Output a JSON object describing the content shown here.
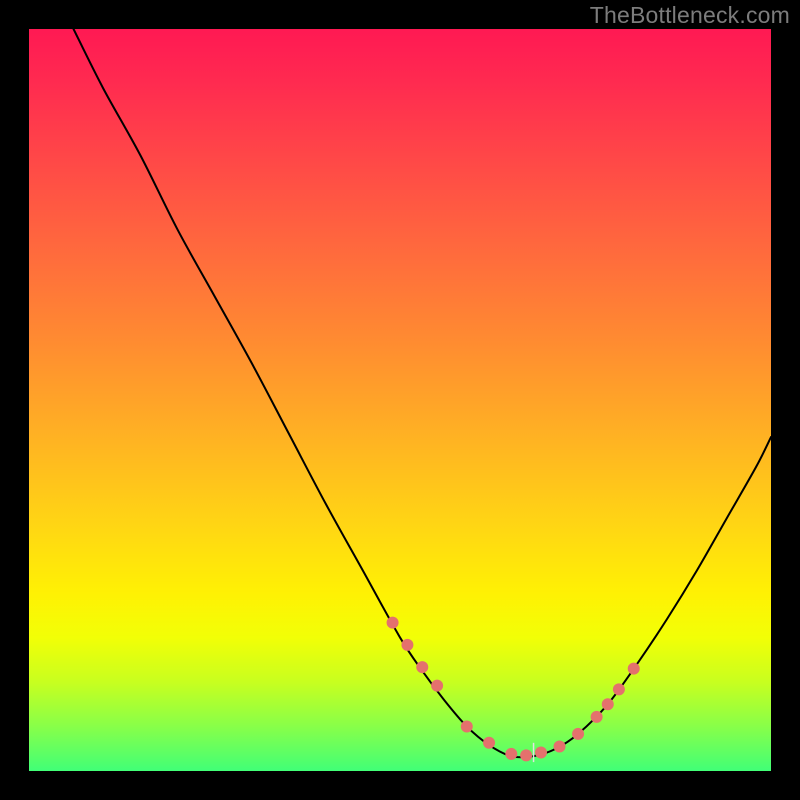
{
  "watermark": "TheBottleneck.com",
  "chart_data": {
    "type": "line",
    "title": "",
    "xlabel": "",
    "ylabel": "",
    "xlim": [
      0,
      100
    ],
    "ylim": [
      0,
      100
    ],
    "series": [
      {
        "name": "bottleneck-curve",
        "x": [
          6,
          10,
          15,
          20,
          25,
          30,
          35,
          40,
          45,
          50,
          53,
          56,
          59,
          62,
          65,
          68,
          71,
          74,
          78,
          82,
          86,
          90,
          94,
          98,
          100
        ],
        "y": [
          100,
          92,
          83,
          73,
          64,
          55,
          45.5,
          36,
          27,
          18,
          13.5,
          9.5,
          6,
          3.5,
          2,
          2,
          3,
          5,
          9,
          14.5,
          20.5,
          27,
          34,
          41,
          45
        ]
      }
    ],
    "markers": {
      "name": "highlight-dots",
      "x": [
        49,
        51,
        53,
        55,
        59,
        62,
        65,
        67,
        69,
        71.5,
        74,
        76.5,
        78,
        79.5,
        81.5
      ],
      "y": [
        20,
        17,
        14,
        11.5,
        6,
        3.8,
        2.3,
        2.1,
        2.5,
        3.3,
        5.0,
        7.3,
        9.0,
        11.0,
        13.8
      ],
      "color": "#e4716d",
      "radius": 6
    },
    "green_tick": {
      "x": 68,
      "y_top": 3.8,
      "y_bottom": 1.2,
      "color": "#e2e2e2"
    }
  }
}
